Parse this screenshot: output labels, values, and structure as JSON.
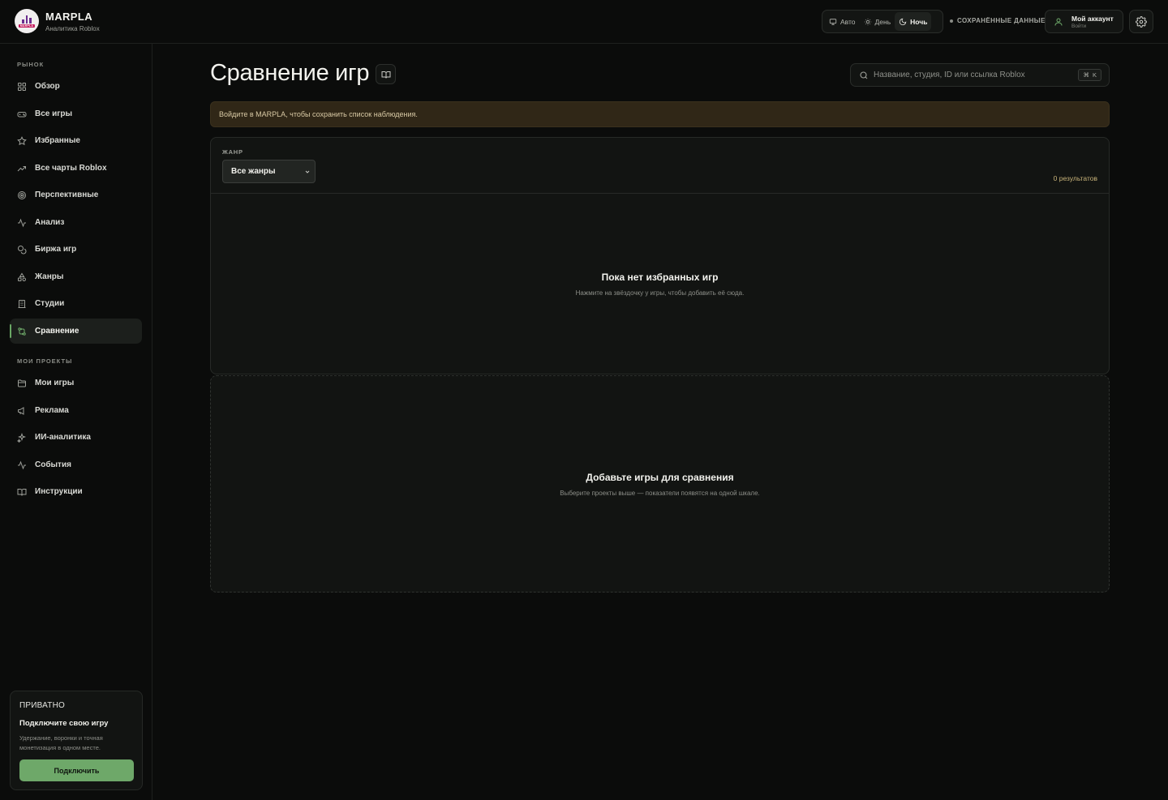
{
  "brand": {
    "name": "MARPLA",
    "subtitle": "Аналитика Roblox",
    "logo_tag": "MARPLA"
  },
  "header": {
    "theme_options": [
      {
        "label": "Авто",
        "icon": "monitor-icon",
        "active": false
      },
      {
        "label": "День",
        "icon": "sun-icon",
        "active": false
      },
      {
        "label": "Ночь",
        "icon": "moon-icon",
        "active": true
      }
    ],
    "saved_data_label": "СОХРАНЁННЫЕ ДАННЫЕ",
    "account": {
      "title": "Мой аккаунт",
      "subtitle": "Войти",
      "icon": "user-icon"
    },
    "settings_icon": "gear-icon"
  },
  "sidebar": {
    "market_section": "РЫНОК",
    "market_items": [
      {
        "label": "Обзор",
        "icon": "grid-icon",
        "active": false
      },
      {
        "label": "Все игры",
        "icon": "gamepad-icon",
        "active": false
      },
      {
        "label": "Избранные",
        "icon": "star-icon",
        "active": false
      },
      {
        "label": "Все чарты Roblox",
        "icon": "trending-up-icon",
        "active": false
      },
      {
        "label": "Перспективные",
        "icon": "target-icon",
        "active": false
      },
      {
        "label": "Анализ",
        "icon": "activity-icon",
        "active": false
      },
      {
        "label": "Биржа игр",
        "icon": "coins-icon",
        "active": false
      },
      {
        "label": "Жанры",
        "icon": "shapes-icon",
        "active": false
      },
      {
        "label": "Студии",
        "icon": "building-icon",
        "active": false
      },
      {
        "label": "Сравнение",
        "icon": "compare-icon",
        "active": true
      }
    ],
    "projects_section": "МОИ ПРОЕКТЫ",
    "project_items": [
      {
        "label": "Мои игры",
        "icon": "folder-icon"
      },
      {
        "label": "Реклама",
        "icon": "megaphone-icon"
      },
      {
        "label": "ИИ-аналитика",
        "icon": "sparkles-icon"
      },
      {
        "label": "События",
        "icon": "pulse-icon"
      },
      {
        "label": "Инструкции",
        "icon": "book-icon"
      }
    ],
    "promo": {
      "tag": "ПРИВАТНО",
      "title": "Подключите свою игру",
      "description": "Удержание, воронки и точная монетизация в одном месте.",
      "button": "Подключить"
    }
  },
  "main": {
    "title": "Сравнение игр",
    "guide_icon": "book-open-icon",
    "search": {
      "placeholder": "Название, студия, ID или ссылка Roblox",
      "shortcut_symbol": "⌘",
      "shortcut_key": "K"
    },
    "notice": "Войдите в MARPLA, чтобы сохранить список наблюдения.",
    "filters": {
      "genre_label": "ЖАНР",
      "genre_value": "Все жанры",
      "results": "0 результатов"
    },
    "favorites_empty": {
      "title": "Пока нет избранных игр",
      "description": "Нажмите на звёздочку у игры, чтобы добавить её сюда."
    },
    "compare_empty": {
      "title": "Добавьте игры для сравнения",
      "description": "Выберите проекты выше — показатели появятся на одной шкале."
    }
  },
  "colors": {
    "background": "#0b0c0b",
    "panel": "#121412",
    "accent": "#6ea869",
    "notice_bg": "#302717",
    "results_text": "#c9b47a"
  }
}
